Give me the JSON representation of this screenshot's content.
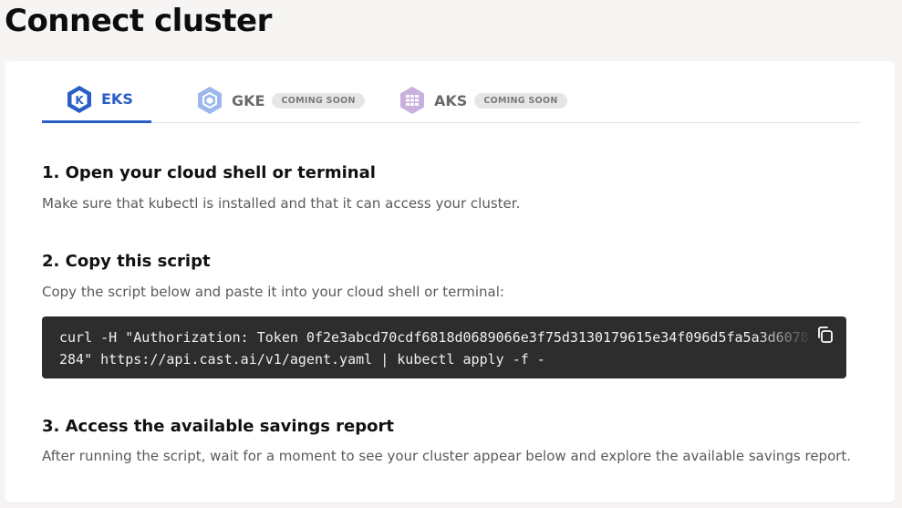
{
  "page": {
    "title": "Connect cluster"
  },
  "tabs": [
    {
      "label": "EKS",
      "badge": "",
      "icon": "kubernetes-k-icon",
      "active": true
    },
    {
      "label": "GKE",
      "badge": "COMING SOON",
      "icon": "gke-hexagon-icon",
      "active": false
    },
    {
      "label": "AKS",
      "badge": "COMING SOON",
      "icon": "aks-hexagon-icon",
      "active": false
    }
  ],
  "steps": [
    {
      "title": "1. Open your cloud shell or terminal",
      "description": "Make sure that kubectl is installed and that it can access your cluster."
    },
    {
      "title": "2. Copy this script",
      "description": "Copy the script below and paste it into your cloud shell or terminal:"
    },
    {
      "title": "3. Access the available savings report",
      "description": "After running the script, wait for a moment to see your cluster appear below and explore the available savings report."
    }
  ],
  "script": {
    "code": "curl -H \"Authorization: Token 0f2e3abcd70cdf6818d0689066e3f75d3130179615e34f096d5fa5a3d6078284\" https://api.cast.ai/v1/agent.yaml | kubectl apply -f -",
    "copy_icon": "copy-icon"
  },
  "colors": {
    "accent": "#2a5ec6",
    "code_bg": "#2d2d2d",
    "badge_bg": "#e6e6e6",
    "page_bg": "#f6f5f4"
  }
}
